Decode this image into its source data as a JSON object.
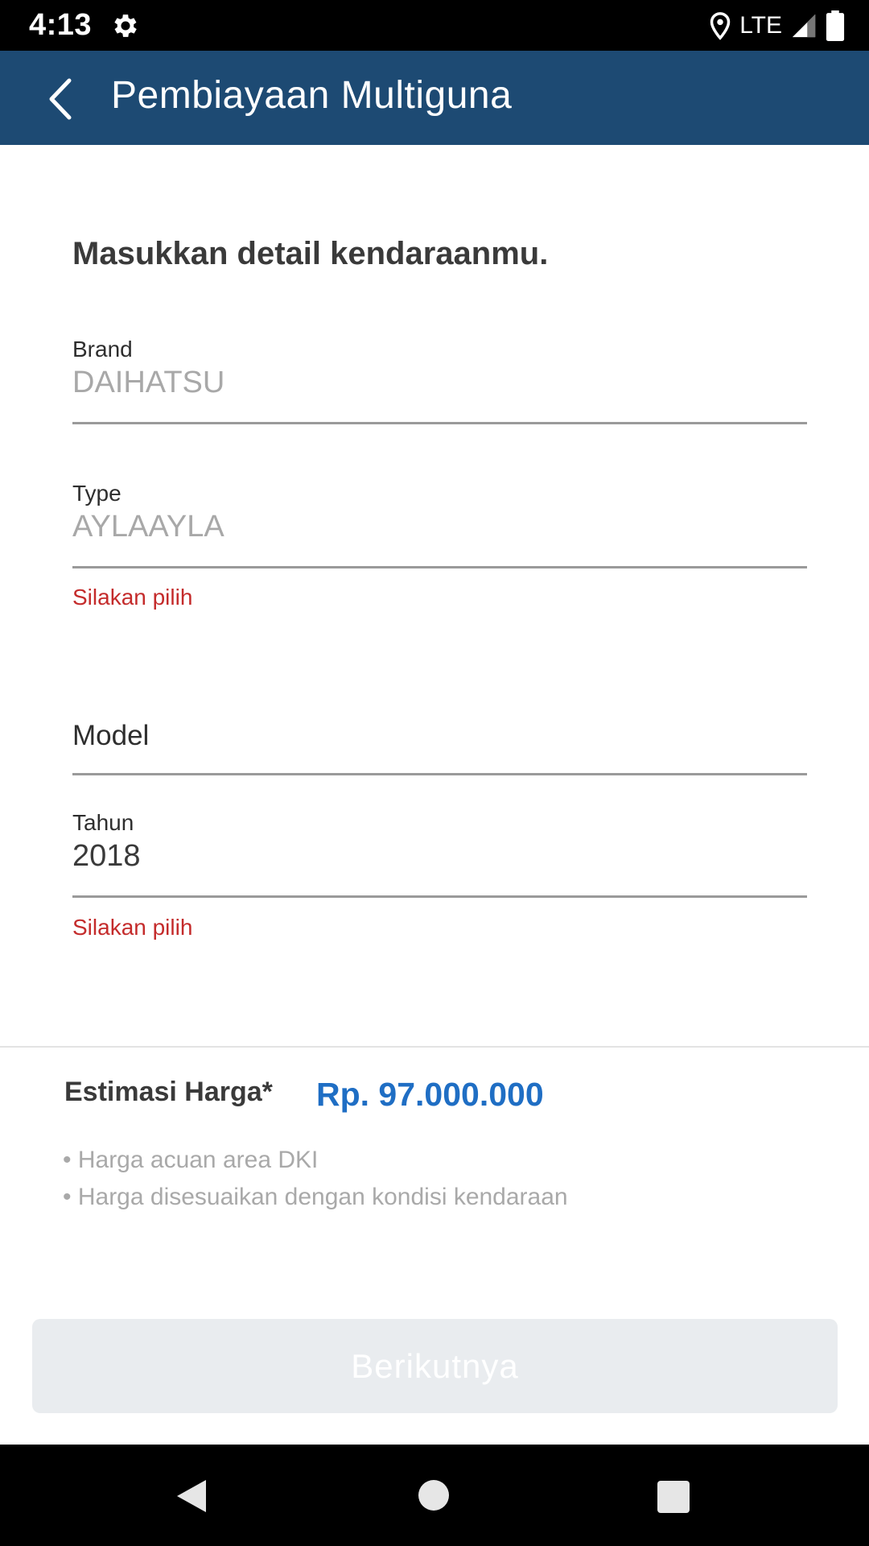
{
  "status_bar": {
    "time": "4:13",
    "network": "LTE",
    "icons": [
      "gear-icon",
      "location-icon",
      "signal-icon",
      "battery-icon"
    ]
  },
  "app_bar": {
    "title": "Pembiayaan Multiguna",
    "back_icon": "chevron-left-icon"
  },
  "form": {
    "heading": "Masukkan detail kendaraanmu.",
    "brand": {
      "label": "Brand",
      "value": "DAIHATSU"
    },
    "type": {
      "label": "Type",
      "value": "AYLAAYLA",
      "error": "Silakan pilih"
    },
    "model": {
      "label": "Model",
      "value": ""
    },
    "year": {
      "label": "Tahun",
      "value": "2018",
      "error": "Silakan pilih"
    }
  },
  "estimate": {
    "label": "Estimasi Harga*",
    "value": "Rp. 97.000.000",
    "notes": [
      "• Harga acuan area DKI",
      "• Harga disesuaikan dengan kondisi kendaraan"
    ]
  },
  "actions": {
    "next_label": "Berikutnya"
  },
  "nav_bar": {
    "icons": [
      "nav-back-icon",
      "nav-home-icon",
      "nav-recent-icon"
    ]
  },
  "colors": {
    "app_bar": "#1d4a73",
    "accent": "#1f6ec4",
    "error": "#c42b2b",
    "button_disabled": "#e9ecef"
  }
}
